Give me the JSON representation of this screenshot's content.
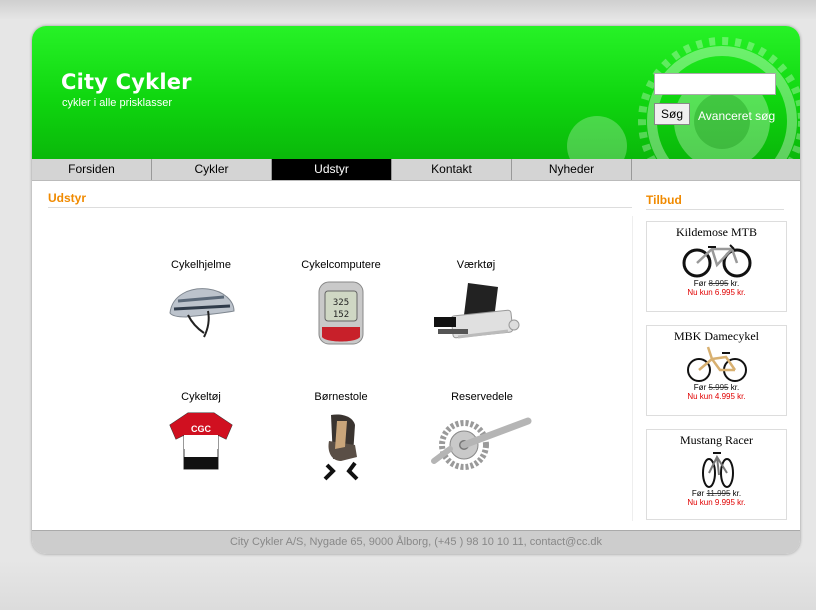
{
  "header": {
    "title": "City Cykler",
    "subtitle": "cykler i alle prisklasser",
    "search": {
      "value": "",
      "button_label": "Søg",
      "advanced_link": "Avanceret søg"
    }
  },
  "nav": {
    "items": [
      {
        "label": "Forsiden"
      },
      {
        "label": "Cykler"
      },
      {
        "label": "Udstyr",
        "active": true
      },
      {
        "label": "Kontakt"
      },
      {
        "label": "Nyheder"
      }
    ]
  },
  "main": {
    "title": "Udstyr",
    "categories": [
      {
        "label": "Cykelhjelme",
        "icon": "helmet-icon"
      },
      {
        "label": "Cykelcomputere",
        "icon": "bike-computer-icon"
      },
      {
        "label": "Værktøj",
        "icon": "tool-kit-icon"
      },
      {
        "label": "Cykeltøj",
        "icon": "jersey-icon"
      },
      {
        "label": "Børnestole",
        "icon": "child-seat-icon"
      },
      {
        "label": "Reservedele",
        "icon": "crankset-icon"
      }
    ]
  },
  "sidebar": {
    "title": "Tilbud",
    "offers": [
      {
        "name": "Kildemose MTB",
        "before_prefix": "Før",
        "before_price": "8.995",
        "before_suffix": "kr.",
        "now": "Nu kun 6.995 kr.",
        "icon": "mountain-bike-icon"
      },
      {
        "name": "MBK Damecykel",
        "before_prefix": "Før",
        "before_price": "5.995",
        "before_suffix": "kr.",
        "now": "Nu kun 4.995 kr.",
        "icon": "city-bike-icon"
      },
      {
        "name": "Mustang Racer",
        "before_prefix": "Før",
        "before_price": "11.995",
        "before_suffix": "kr.",
        "now": "Nu kun 9.995 kr.",
        "icon": "racing-bike-icon"
      }
    ]
  },
  "footer": {
    "text": "City Cykler A/S, Nygade 65, 9000 Ålborg, (+45 ) 98 10 10 11, contact@cc.dk"
  },
  "colors": {
    "header_green": "#1be21b",
    "accent_orange": "#f08a00",
    "price_red": "#e00000",
    "nav_active": "#000000"
  }
}
